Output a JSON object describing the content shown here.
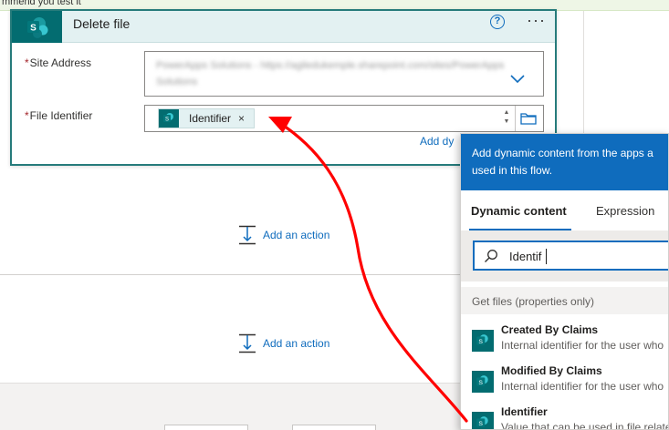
{
  "notice": {
    "text": "mmend you test it"
  },
  "card": {
    "title": "Delete file",
    "help_glyph": "?",
    "more_glyph": "···",
    "site_address": {
      "required_mark": "*",
      "label": "Site Address",
      "value_line1": "PowerApps Solutions - https://agiledukemple.sharepoint.com/sites/PowerApps",
      "value_line2": "Solutions"
    },
    "file_identifier": {
      "required_mark": "*",
      "label": "File Identifier",
      "token_label": "Identifier",
      "token_remove": "×"
    },
    "add_dynamic_link": "Add dy"
  },
  "add_action": {
    "label": "Add an action"
  },
  "dynamic_panel": {
    "header_line1": "Add dynamic content from the apps a",
    "header_line2": "used in this flow.",
    "tabs": [
      {
        "label": "Dynamic content",
        "active": true
      },
      {
        "label": "Expression",
        "active": false
      }
    ],
    "search": {
      "value": "Identif"
    },
    "group_title": "Get files (properties only)",
    "items": [
      {
        "name": "Created By Claims",
        "description": "Internal identifier for the user who"
      },
      {
        "name": "Modified By Claims",
        "description": "Internal identifier for the user who"
      },
      {
        "name": "Identifier",
        "description": "Value that can be used in file relate"
      }
    ]
  },
  "colors": {
    "accent": "#0f6cbd",
    "sharepoint": "#036c70",
    "card_border": "#267b7b",
    "arrow": "#ff0000"
  },
  "icons": [
    "sharepoint-icon",
    "help-icon",
    "more-icon",
    "chevron-down-icon",
    "folder-icon",
    "remove-icon",
    "add-action-icon",
    "search-icon"
  ]
}
